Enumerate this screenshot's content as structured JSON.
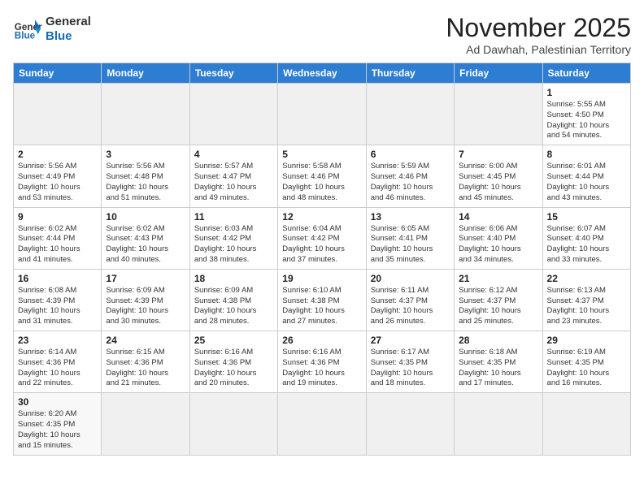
{
  "header": {
    "logo_general": "General",
    "logo_blue": "Blue",
    "month": "November 2025",
    "location": "Ad Dawhah, Palestinian Territory"
  },
  "weekdays": [
    "Sunday",
    "Monday",
    "Tuesday",
    "Wednesday",
    "Thursday",
    "Friday",
    "Saturday"
  ],
  "weeks": [
    [
      {
        "day": "",
        "info": ""
      },
      {
        "day": "",
        "info": ""
      },
      {
        "day": "",
        "info": ""
      },
      {
        "day": "",
        "info": ""
      },
      {
        "day": "",
        "info": ""
      },
      {
        "day": "",
        "info": ""
      },
      {
        "day": "1",
        "info": "Sunrise: 5:55 AM\nSunset: 4:50 PM\nDaylight: 10 hours\nand 54 minutes."
      }
    ],
    [
      {
        "day": "2",
        "info": "Sunrise: 5:56 AM\nSunset: 4:49 PM\nDaylight: 10 hours\nand 53 minutes."
      },
      {
        "day": "3",
        "info": "Sunrise: 5:56 AM\nSunset: 4:48 PM\nDaylight: 10 hours\nand 51 minutes."
      },
      {
        "day": "4",
        "info": "Sunrise: 5:57 AM\nSunset: 4:47 PM\nDaylight: 10 hours\nand 49 minutes."
      },
      {
        "day": "5",
        "info": "Sunrise: 5:58 AM\nSunset: 4:46 PM\nDaylight: 10 hours\nand 48 minutes."
      },
      {
        "day": "6",
        "info": "Sunrise: 5:59 AM\nSunset: 4:46 PM\nDaylight: 10 hours\nand 46 minutes."
      },
      {
        "day": "7",
        "info": "Sunrise: 6:00 AM\nSunset: 4:45 PM\nDaylight: 10 hours\nand 45 minutes."
      },
      {
        "day": "8",
        "info": "Sunrise: 6:01 AM\nSunset: 4:44 PM\nDaylight: 10 hours\nand 43 minutes."
      }
    ],
    [
      {
        "day": "9",
        "info": "Sunrise: 6:02 AM\nSunset: 4:44 PM\nDaylight: 10 hours\nand 41 minutes."
      },
      {
        "day": "10",
        "info": "Sunrise: 6:02 AM\nSunset: 4:43 PM\nDaylight: 10 hours\nand 40 minutes."
      },
      {
        "day": "11",
        "info": "Sunrise: 6:03 AM\nSunset: 4:42 PM\nDaylight: 10 hours\nand 38 minutes."
      },
      {
        "day": "12",
        "info": "Sunrise: 6:04 AM\nSunset: 4:42 PM\nDaylight: 10 hours\nand 37 minutes."
      },
      {
        "day": "13",
        "info": "Sunrise: 6:05 AM\nSunset: 4:41 PM\nDaylight: 10 hours\nand 35 minutes."
      },
      {
        "day": "14",
        "info": "Sunrise: 6:06 AM\nSunset: 4:40 PM\nDaylight: 10 hours\nand 34 minutes."
      },
      {
        "day": "15",
        "info": "Sunrise: 6:07 AM\nSunset: 4:40 PM\nDaylight: 10 hours\nand 33 minutes."
      }
    ],
    [
      {
        "day": "16",
        "info": "Sunrise: 6:08 AM\nSunset: 4:39 PM\nDaylight: 10 hours\nand 31 minutes."
      },
      {
        "day": "17",
        "info": "Sunrise: 6:09 AM\nSunset: 4:39 PM\nDaylight: 10 hours\nand 30 minutes."
      },
      {
        "day": "18",
        "info": "Sunrise: 6:09 AM\nSunset: 4:38 PM\nDaylight: 10 hours\nand 28 minutes."
      },
      {
        "day": "19",
        "info": "Sunrise: 6:10 AM\nSunset: 4:38 PM\nDaylight: 10 hours\nand 27 minutes."
      },
      {
        "day": "20",
        "info": "Sunrise: 6:11 AM\nSunset: 4:37 PM\nDaylight: 10 hours\nand 26 minutes."
      },
      {
        "day": "21",
        "info": "Sunrise: 6:12 AM\nSunset: 4:37 PM\nDaylight: 10 hours\nand 25 minutes."
      },
      {
        "day": "22",
        "info": "Sunrise: 6:13 AM\nSunset: 4:37 PM\nDaylight: 10 hours\nand 23 minutes."
      }
    ],
    [
      {
        "day": "23",
        "info": "Sunrise: 6:14 AM\nSunset: 4:36 PM\nDaylight: 10 hours\nand 22 minutes."
      },
      {
        "day": "24",
        "info": "Sunrise: 6:15 AM\nSunset: 4:36 PM\nDaylight: 10 hours\nand 21 minutes."
      },
      {
        "day": "25",
        "info": "Sunrise: 6:16 AM\nSunset: 4:36 PM\nDaylight: 10 hours\nand 20 minutes."
      },
      {
        "day": "26",
        "info": "Sunrise: 6:16 AM\nSunset: 4:36 PM\nDaylight: 10 hours\nand 19 minutes."
      },
      {
        "day": "27",
        "info": "Sunrise: 6:17 AM\nSunset: 4:35 PM\nDaylight: 10 hours\nand 18 minutes."
      },
      {
        "day": "28",
        "info": "Sunrise: 6:18 AM\nSunset: 4:35 PM\nDaylight: 10 hours\nand 17 minutes."
      },
      {
        "day": "29",
        "info": "Sunrise: 6:19 AM\nSunset: 4:35 PM\nDaylight: 10 hours\nand 16 minutes."
      }
    ],
    [
      {
        "day": "30",
        "info": "Sunrise: 6:20 AM\nSunset: 4:35 PM\nDaylight: 10 hours\nand 15 minutes."
      },
      {
        "day": "",
        "info": ""
      },
      {
        "day": "",
        "info": ""
      },
      {
        "day": "",
        "info": ""
      },
      {
        "day": "",
        "info": ""
      },
      {
        "day": "",
        "info": ""
      },
      {
        "day": "",
        "info": ""
      }
    ]
  ]
}
